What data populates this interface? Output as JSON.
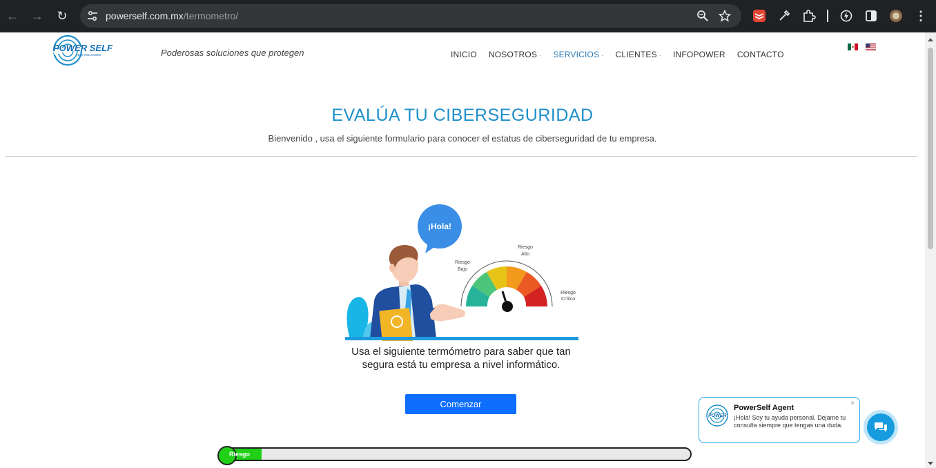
{
  "browser": {
    "url_domain": "powerself.com.mx",
    "url_path": "/termometro/"
  },
  "site": {
    "brand": "POWER SELF",
    "brand_sub": "TECHNOLOGIES",
    "tagline": "Poderosas soluciones que protegen",
    "menu": [
      {
        "label": "INICIO"
      },
      {
        "label": "NOSOTROS",
        "caret": "·"
      },
      {
        "label": "SERVICIOS",
        "caret": "·"
      },
      {
        "label": "CLIENTES",
        "caret": "·"
      },
      {
        "label": "INFOPOWER"
      },
      {
        "label": "CONTACTO"
      }
    ],
    "active_menu": "SERVICIOS"
  },
  "hero": {
    "title": "EVALÚA TU CIBERSEGURIDAD",
    "subtitle": "Bienvenido , usa el siguiente formulario para conocer el estatus de ciberseguridad de tu empresa."
  },
  "illustration": {
    "bubble": "¡Hola!",
    "labels": {
      "bajo_1": "Riesgo",
      "bajo_2": "Bajo",
      "alto_1": "Riesgo",
      "alto_2": "Alto",
      "critico_1": "Riesgo",
      "critico_2": "Crítico"
    }
  },
  "cta": {
    "text": "Usa el siguiente termómetro para saber que tan segura está tu empresa a nivel informático.",
    "button": "Comenzar"
  },
  "meter": {
    "label": "Riesgo",
    "fill_fraction": 0.09
  },
  "chat": {
    "agent": "PowerSelf Agent",
    "message": "¡Hola! Soy tu ayuda personal. Dejame tu consulta siempre que tengas una duda.",
    "close": "×"
  },
  "colors": {
    "accent": "#1e8fc9",
    "button": "#0d6efd",
    "meter_fill": "#1fd016",
    "chat": "#169bde"
  }
}
